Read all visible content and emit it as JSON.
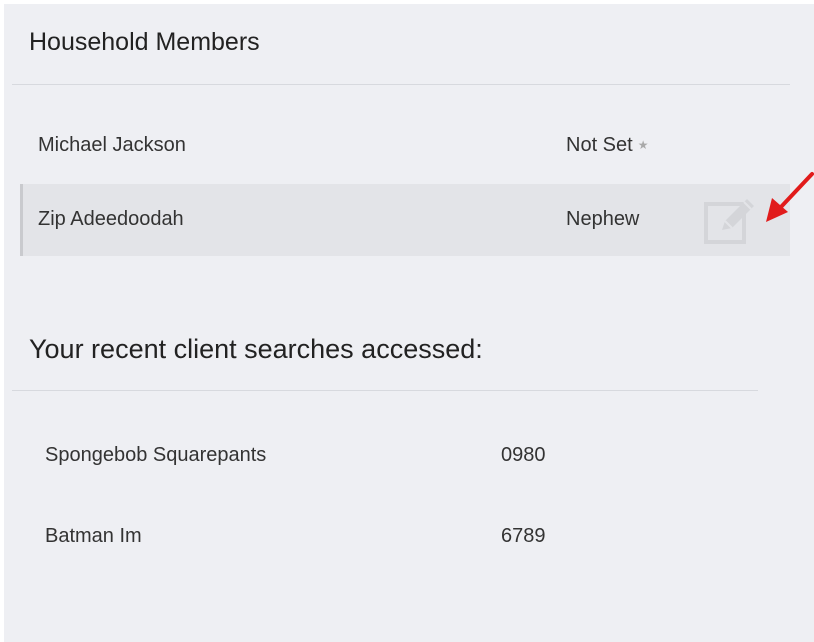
{
  "household": {
    "title": "Household Members",
    "members": [
      {
        "name": "Michael Jackson",
        "relation": "Not Set",
        "primary_icon": "star-icon"
      },
      {
        "name": "Zip Adeedoodah",
        "relation": "Nephew",
        "action_icon": "edit-icon"
      }
    ]
  },
  "recent": {
    "title": "Your recent client searches accessed:",
    "items": [
      {
        "name": "Spongebob Squarepants",
        "id": "0980"
      },
      {
        "name": "Batman Im",
        "id": "6789"
      }
    ]
  },
  "colors": {
    "panel_bg": "#eeeff3",
    "hover_row_bg": "#e3e4e8",
    "annotation_arrow": "#e11b1b"
  }
}
